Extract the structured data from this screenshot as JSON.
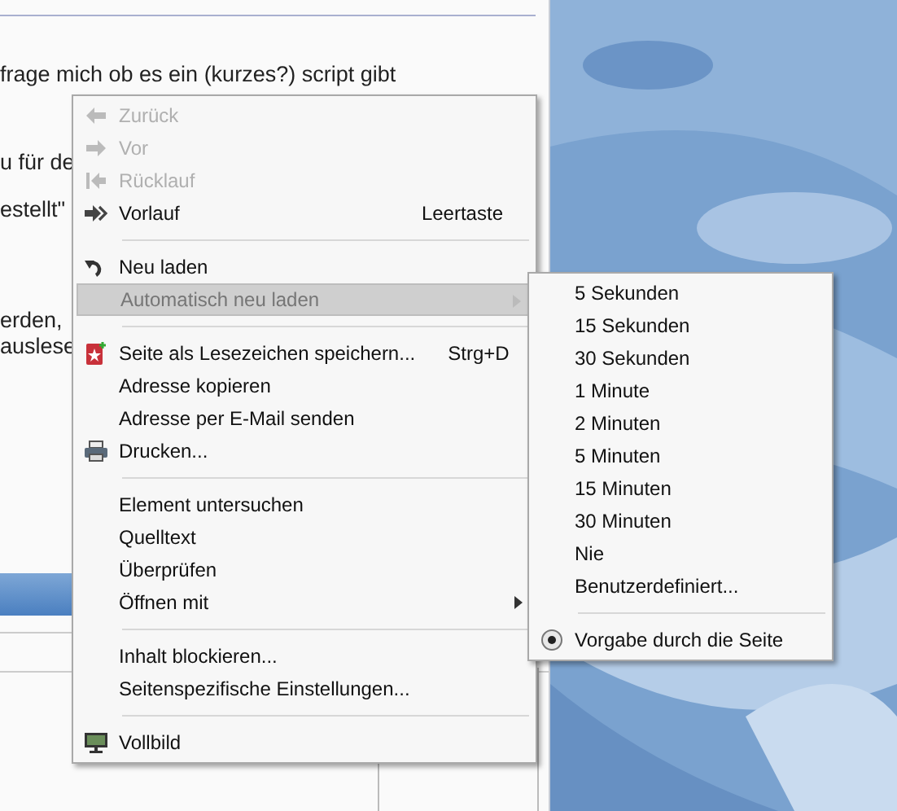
{
  "page_text": [
    "frage mich ob es ein (kurzes?) script gibt",
    "u für de",
    "estellt\"",
    "erden,",
    "auslese"
  ],
  "context_menu": [
    {
      "kind": "item",
      "label": "Zurück",
      "disabled": true,
      "highlighted": false,
      "submenu": false
    },
    {
      "kind": "item",
      "label": "Vor",
      "disabled": true,
      "highlighted": false,
      "submenu": false
    },
    {
      "kind": "item",
      "label": "Rücklauf",
      "disabled": true,
      "highlighted": false,
      "submenu": false
    },
    {
      "kind": "item",
      "label": "Vorlauf",
      "shortcut": "Leertaste",
      "disabled": false,
      "highlighted": false,
      "submenu": false
    },
    {
      "kind": "separator"
    },
    {
      "kind": "item",
      "label": "Neu laden",
      "disabled": false,
      "highlighted": false,
      "submenu": false
    },
    {
      "kind": "item",
      "label": "Automatisch neu laden",
      "disabled": true,
      "highlighted": true,
      "submenu": true
    },
    {
      "kind": "separator"
    },
    {
      "kind": "item",
      "label": "Seite als Lesezeichen speichern...",
      "shortcut": "Strg+D",
      "disabled": false,
      "highlighted": false,
      "submenu": false
    },
    {
      "kind": "item",
      "label": "Adresse kopieren",
      "disabled": false,
      "highlighted": false,
      "submenu": false
    },
    {
      "kind": "item",
      "label": "Adresse per E-Mail senden",
      "disabled": false,
      "highlighted": false,
      "submenu": false
    },
    {
      "kind": "item",
      "label": "Drucken...",
      "disabled": false,
      "highlighted": false,
      "submenu": false
    },
    {
      "kind": "separator"
    },
    {
      "kind": "item",
      "label": "Element untersuchen",
      "disabled": false,
      "highlighted": false,
      "submenu": false
    },
    {
      "kind": "item",
      "label": "Quelltext",
      "disabled": false,
      "highlighted": false,
      "submenu": false
    },
    {
      "kind": "item",
      "label": "Überprüfen",
      "disabled": false,
      "highlighted": false,
      "submenu": false
    },
    {
      "kind": "item",
      "label": "Öffnen mit",
      "disabled": false,
      "highlighted": false,
      "submenu": true
    },
    {
      "kind": "separator"
    },
    {
      "kind": "item",
      "label": "Inhalt blockieren...",
      "disabled": false,
      "highlighted": false,
      "submenu": false
    },
    {
      "kind": "item",
      "label": "Seitenspezifische Einstellungen...",
      "disabled": false,
      "highlighted": false,
      "submenu": false
    },
    {
      "kind": "separator"
    },
    {
      "kind": "item",
      "label": "Vollbild",
      "disabled": false,
      "highlighted": false,
      "submenu": false
    }
  ],
  "submenu": [
    {
      "kind": "item",
      "label": "5 Sekunden"
    },
    {
      "kind": "item",
      "label": "15 Sekunden"
    },
    {
      "kind": "item",
      "label": "30 Sekunden"
    },
    {
      "kind": "item",
      "label": "1 Minute"
    },
    {
      "kind": "item",
      "label": "2 Minuten"
    },
    {
      "kind": "item",
      "label": "5 Minuten"
    },
    {
      "kind": "item",
      "label": "15 Minuten"
    },
    {
      "kind": "item",
      "label": "30 Minuten"
    },
    {
      "kind": "item",
      "label": "Nie"
    },
    {
      "kind": "item",
      "label": "Benutzerdefiniert..."
    },
    {
      "kind": "separator"
    },
    {
      "kind": "radio",
      "label": "Vorgabe durch die Seite",
      "selected": true
    }
  ]
}
